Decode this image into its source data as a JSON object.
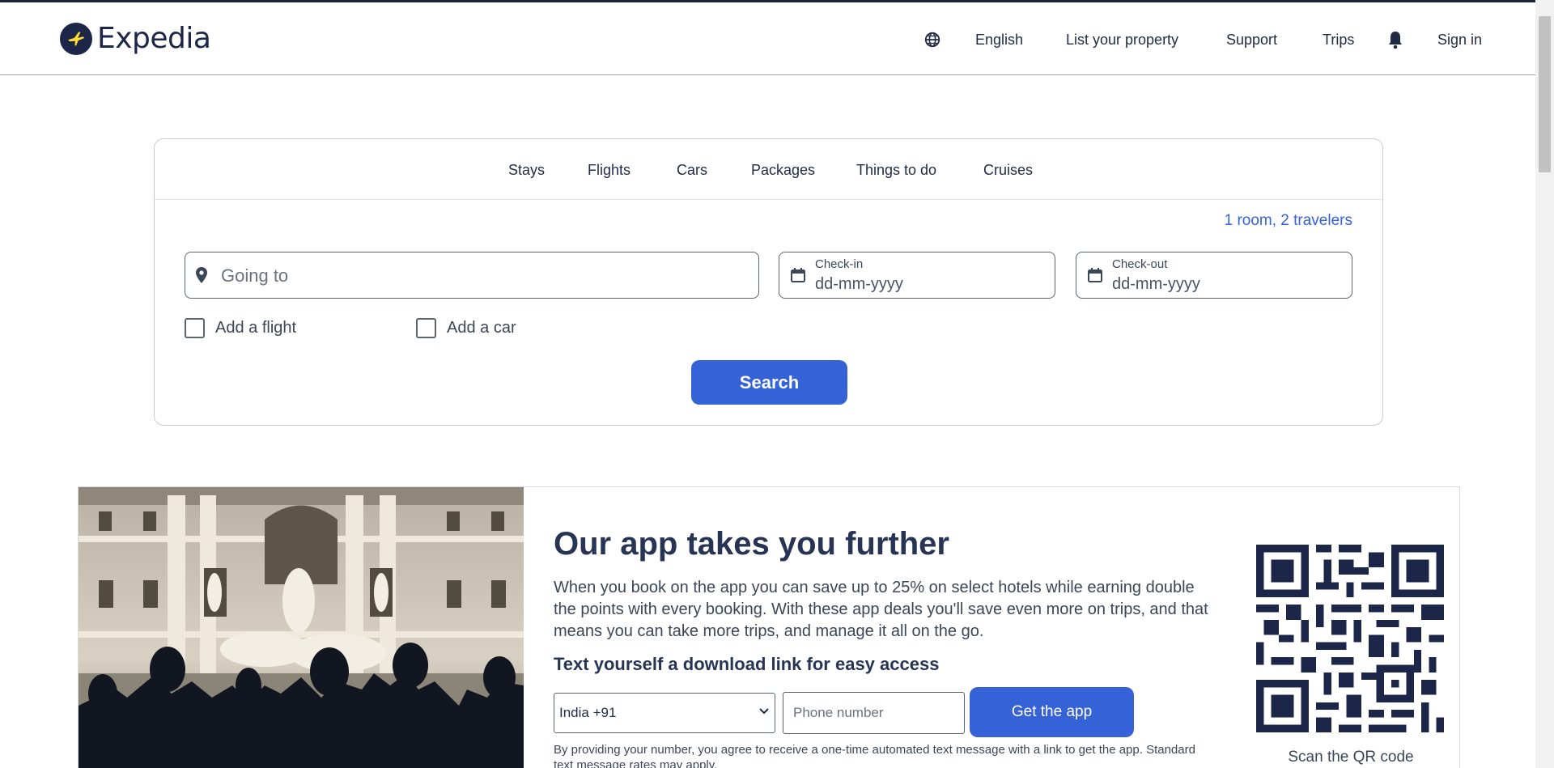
{
  "header": {
    "logo_text": "Expedia",
    "nav": {
      "language": "English",
      "list_property": "List your property",
      "support": "Support",
      "trips": "Trips",
      "sign_in": "Sign in"
    }
  },
  "search": {
    "tabs": [
      "Stays",
      "Flights",
      "Cars",
      "Packages",
      "Things to do",
      "Cruises"
    ],
    "travelers": "1 room, 2 travelers",
    "destination_placeholder": "Going to",
    "checkin_label": "Check-in",
    "checkin_value": "dd-mm-yyyy",
    "checkout_label": "Check-out",
    "checkout_value": "dd-mm-yyyy",
    "add_flight": "Add a flight",
    "add_car": "Add a car",
    "search_button": "Search"
  },
  "promo": {
    "title": "Our app takes you further",
    "text": "When you book on the app you can save up to 25% on select hotels while earning double the points with every booking. With these app deals you'll save even more on trips, and that means you can take more trips, and manage it all on the go.",
    "subtitle": "Text yourself a download link for easy access",
    "country_selected": "India +91",
    "phone_placeholder": "Phone number",
    "get_app_button": "Get the app",
    "disclaimer": "By providing your number, you agree to receive a one-time automated text message with a link to get the app. Standard text message rates may apply.",
    "qr_caption": "Scan the QR code"
  },
  "colors": {
    "brand_navy": "#1c2649",
    "accent_blue": "#3662d8",
    "logo_yellow": "#fddb32"
  }
}
